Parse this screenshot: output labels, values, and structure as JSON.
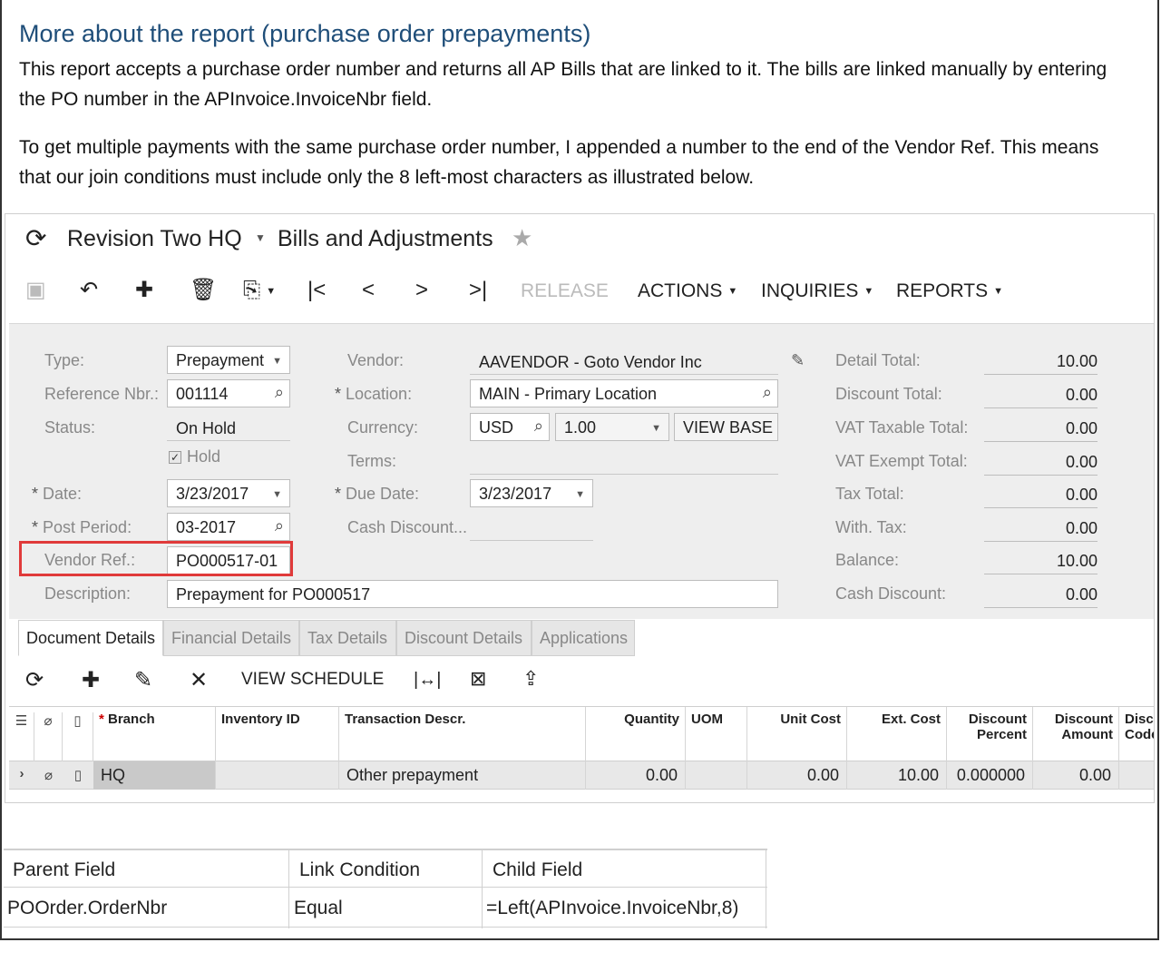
{
  "document": {
    "heading": "More about the report (purchase order prepayments)",
    "para1": "This report accepts a purchase order number and returns all AP Bills that are linked to it. The bills are linked manually by entering the PO number in the APInvoice.InvoiceNbr field.",
    "para2": "To get multiple payments with the same purchase order number, I appended a number to the end of the Vendor Ref. This means that our join conditions must include only the 8 left-most characters as illustrated below."
  },
  "screen": {
    "company": "Revision Two HQ",
    "title": "Bills and Adjustments",
    "toolbar": {
      "release": "RELEASE",
      "actions": "ACTIONS",
      "inquiries": "INQUIRIES",
      "reports": "REPORTS"
    },
    "form": {
      "type_label": "Type:",
      "type_value": "Prepayment",
      "refnbr_label": "Reference Nbr.:",
      "refnbr_value": "001114",
      "status_label": "Status:",
      "status_value": "On Hold",
      "hold_label": "Hold",
      "date_label": "Date:",
      "date_value": "3/23/2017",
      "postperiod_label": "Post Period:",
      "postperiod_value": "03-2017",
      "vendorref_label": "Vendor Ref.:",
      "vendorref_value": "PO000517-01",
      "description_label": "Description:",
      "description_value": "Prepayment for PO000517",
      "vendor_label": "Vendor:",
      "vendor_value": "AAVENDOR - Goto Vendor Inc",
      "location_label": "Location:",
      "location_value": "MAIN - Primary Location",
      "currency_label": "Currency:",
      "currency_value": "USD",
      "currency_rate": "1.00",
      "view_base": "VIEW BASE",
      "terms_label": "Terms:",
      "duedate_label": "Due Date:",
      "duedate_value": "3/23/2017",
      "cashdisc_label": "Cash Discount..."
    },
    "totals": [
      {
        "label": "Detail Total:",
        "value": "10.00"
      },
      {
        "label": "Discount Total:",
        "value": "0.00"
      },
      {
        "label": "VAT Taxable Total:",
        "value": "0.00"
      },
      {
        "label": "VAT Exempt Total:",
        "value": "0.00"
      },
      {
        "label": "Tax Total:",
        "value": "0.00"
      },
      {
        "label": "With. Tax:",
        "value": "0.00"
      },
      {
        "label": "Balance:",
        "value": "10.00"
      },
      {
        "label": "Cash Discount:",
        "value": "0.00"
      }
    ],
    "tabs": [
      "Document Details",
      "Financial Details",
      "Tax Details",
      "Discount Details",
      "Applications"
    ],
    "grid_toolbar": {
      "view_schedule": "VIEW SCHEDULE"
    },
    "grid": {
      "headers": {
        "branch": "Branch",
        "inventory": "Inventory ID",
        "descr": "Transaction Descr.",
        "qty": "Quantity",
        "uom": "UOM",
        "unitcost": "Unit Cost",
        "extcost": "Ext. Cost",
        "discpct": "Discount Percent",
        "discamt": "Discount Amount",
        "disccode": "Disc Code"
      },
      "row": {
        "branch": "HQ",
        "inventory": "",
        "descr": "Other prepayment",
        "qty": "0.00",
        "uom": "",
        "unitcost": "0.00",
        "extcost": "10.00",
        "discpct": "0.000000",
        "discamt": "0.00"
      }
    }
  },
  "link_table": {
    "headers": [
      "Parent Field",
      "Link Condition",
      "Child Field"
    ],
    "row": [
      "POOrder.OrderNbr",
      "Equal",
      "=Left(APInvoice.InvoiceNbr,8)"
    ]
  }
}
